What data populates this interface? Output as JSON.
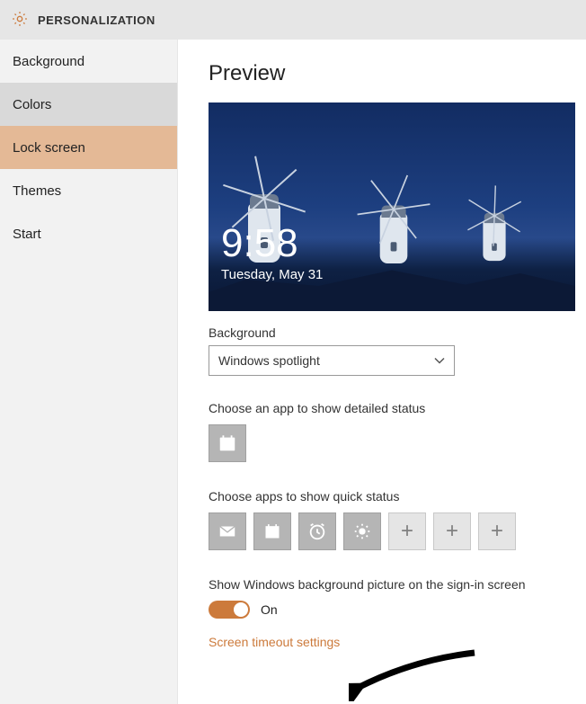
{
  "header": {
    "title": "PERSONALIZATION"
  },
  "sidebar": {
    "items": [
      {
        "label": "Background"
      },
      {
        "label": "Colors"
      },
      {
        "label": "Lock screen"
      },
      {
        "label": "Themes"
      },
      {
        "label": "Start"
      }
    ]
  },
  "main": {
    "page_title": "Preview",
    "clock_time": "9:58",
    "clock_date": "Tuesday, May 31",
    "background_label": "Background",
    "background_value": "Windows spotlight",
    "detailed_label": "Choose an app to show detailed status",
    "detailed_icons": [
      "calendar-icon"
    ],
    "quick_label": "Choose apps to show quick status",
    "quick_icons": [
      "mail-icon",
      "calendar-icon",
      "alarm-icon",
      "weather-icon",
      "add-icon",
      "add-icon",
      "add-icon"
    ],
    "signin_label": "Show Windows background picture on the sign-in screen",
    "toggle_state": "On",
    "timeout_link": "Screen timeout settings"
  },
  "colors": {
    "accent": "#cc7a3b"
  }
}
